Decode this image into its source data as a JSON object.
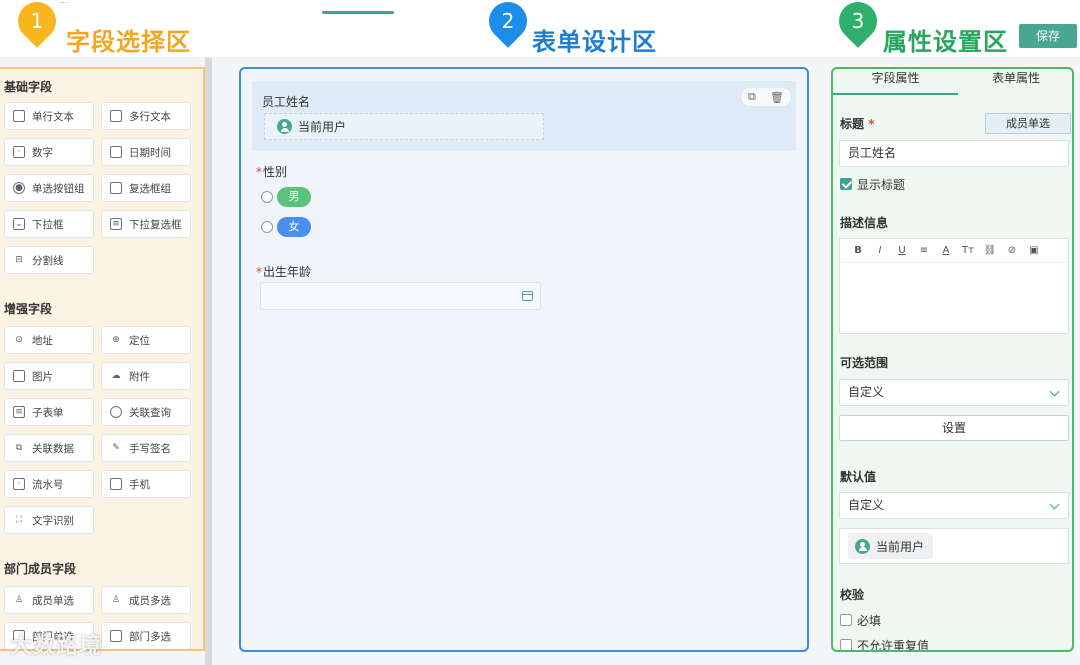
{
  "banner": {
    "zones": [
      {
        "num": "1",
        "title": "字段选择区",
        "color": "#f4a623"
      },
      {
        "num": "2",
        "title": "表单设计区",
        "color": "#1f7ecf"
      },
      {
        "num": "3",
        "title": "属性设置区",
        "color": "#2aa55e"
      }
    ],
    "save_label": "保存"
  },
  "left_panel": {
    "sections": [
      {
        "title": "基础字段",
        "items": [
          {
            "label": "单行文本",
            "icon": "text-line-icon"
          },
          {
            "label": "多行文本",
            "icon": "text-multi-icon"
          },
          {
            "label": "数字",
            "icon": "number-icon"
          },
          {
            "label": "日期时间",
            "icon": "calendar-icon"
          },
          {
            "label": "单选按钮组",
            "icon": "radio-icon"
          },
          {
            "label": "复选框组",
            "icon": "checkbox-icon"
          },
          {
            "label": "下拉框",
            "icon": "dropdown-icon"
          },
          {
            "label": "下拉复选框",
            "icon": "multi-dropdown-icon"
          },
          {
            "label": "分割线",
            "icon": "divider-icon"
          }
        ]
      },
      {
        "title": "增强字段",
        "items": [
          {
            "label": "地址",
            "icon": "map-pin-icon"
          },
          {
            "label": "定位",
            "icon": "locate-icon"
          },
          {
            "label": "图片",
            "icon": "image-icon"
          },
          {
            "label": "附件",
            "icon": "attachment-icon"
          },
          {
            "label": "子表单",
            "icon": "subform-icon"
          },
          {
            "label": "关联查询",
            "icon": "link-query-icon"
          },
          {
            "label": "关联数据",
            "icon": "link-data-icon"
          },
          {
            "label": "手写签名",
            "icon": "signature-icon"
          },
          {
            "label": "流水号",
            "icon": "serial-icon"
          },
          {
            "label": "手机",
            "icon": "phone-icon"
          },
          {
            "label": "文字识别",
            "icon": "ocr-icon"
          }
        ]
      },
      {
        "title": "部门成员字段",
        "items": [
          {
            "label": "成员单选",
            "icon": "member-icon"
          },
          {
            "label": "成员多选",
            "icon": "members-icon"
          },
          {
            "label": "部门单选",
            "icon": "dept-icon"
          },
          {
            "label": "部门多选",
            "icon": "depts-icon"
          }
        ]
      }
    ]
  },
  "form_canvas": {
    "fields": [
      {
        "label": "员工姓名",
        "required": false,
        "value": "当前用户"
      },
      {
        "label": "性别",
        "required": true,
        "options": [
          {
            "label": "男",
            "color": "#5cc17b"
          },
          {
            "label": "女",
            "color": "#4a8ff0"
          }
        ]
      },
      {
        "label": "出生年龄",
        "required": true,
        "value": ""
      }
    ]
  },
  "properties": {
    "tabs": [
      "字段属性",
      "表单属性"
    ],
    "title_label": "标题",
    "required_mark": "*",
    "member_button": "成员单选",
    "title_value": "员工姓名",
    "show_title": "显示标题",
    "description_label": "描述信息",
    "toolbar": [
      "B",
      "I",
      "U",
      "≡",
      "A",
      "Tт",
      "⛓",
      "⊘",
      "▣"
    ],
    "range_label": "可选范围",
    "range_value": "自定义",
    "set_button": "设置",
    "default_label": "默认值",
    "default_value": "自定义",
    "default_user": "当前用户",
    "validation_label": "校验",
    "checks": [
      "必填",
      "不允许重复值"
    ]
  },
  "watermark": "大数路境"
}
